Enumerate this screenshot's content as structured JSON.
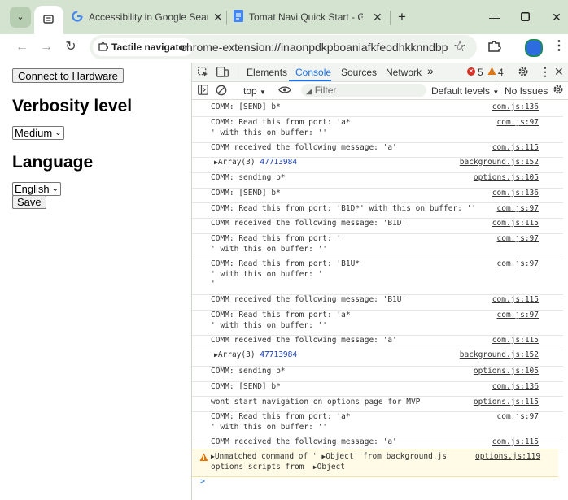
{
  "browser": {
    "tabs": [
      {
        "title": "",
        "favicon": "extension-page-icon",
        "active": true
      },
      {
        "title": "Accessibility in Google Search -",
        "favicon": "google-icon",
        "active": false
      },
      {
        "title": "Tomat Navi Quick Start - Googl",
        "favicon": "docs-icon",
        "active": false
      }
    ],
    "new_tab_symbol": "+",
    "site_chip": "Tactile navigator",
    "url": "chrome-extension://inaonpdkpboaniafkfeodhkknndbpma/o...",
    "colors": {
      "tabstrip": "#d3e3cf",
      "omnibox": "#edf2ec"
    }
  },
  "page": {
    "connect_button": "Connect to Hardware",
    "verbosity_heading": "Verbosity level",
    "verbosity_value": "Medium",
    "language_heading": "Language",
    "language_value": "English",
    "save_button": "Save"
  },
  "devtools": {
    "tabs": [
      "Elements",
      "Console",
      "Sources",
      "Network"
    ],
    "active_tab": "Console",
    "more_tabs": "»",
    "error_count": "5",
    "warning_count": "4",
    "context": "top",
    "filter_placeholder": "Filter",
    "levels": "Default levels",
    "issues": "No Issues",
    "messages": [
      {
        "text": "COMM: [SEND] b*",
        "source": "com.js:136"
      },
      {
        "text": "COMM: Read this from port: 'a*\n' with this on buffer: ''",
        "source": "com.js:97"
      },
      {
        "text": "COMM received the following message: 'a'",
        "source": "com.js:115"
      },
      {
        "text": "Array(3)",
        "extra": "47713984",
        "expandable": true,
        "source": "background.js:152"
      },
      {
        "text": "COMM: sending b*",
        "source": "options.js:105"
      },
      {
        "text": "COMM: [SEND] b*",
        "source": "com.js:136"
      },
      {
        "text": "COMM: Read this from port: 'B1D*' with this on buffer: ''",
        "source": "com.js:97"
      },
      {
        "text": "COMM received the following message: 'B1D'",
        "source": "com.js:115"
      },
      {
        "text": "COMM: Read this from port: '\n' with this on buffer: ''",
        "source": "com.js:97"
      },
      {
        "text": "COMM: Read this from port: 'B1U*\n' with this on buffer: '\n'",
        "source": "com.js:97"
      },
      {
        "text": "COMM received the following message: 'B1U'",
        "source": "com.js:115"
      },
      {
        "text": "COMM: Read this from port: 'a*\n' with this on buffer: ''",
        "source": "com.js:97"
      },
      {
        "text": "COMM received the following message: 'a'",
        "source": "com.js:115"
      },
      {
        "text": "Array(3)",
        "extra": "47713984",
        "expandable": true,
        "source": "background.js:152"
      },
      {
        "text": "COMM: sending b*",
        "source": "options.js:105"
      },
      {
        "text": "COMM: [SEND] b*",
        "source": "com.js:136"
      },
      {
        "text": "wont start navigation on options page for MVP",
        "source": "options.js:115"
      },
      {
        "text": "COMM: Read this from port: 'a*\n' with this on buffer: ''",
        "source": "com.js:97"
      },
      {
        "text": "COMM received the following message: 'a'",
        "source": "com.js:115"
      }
    ],
    "warning": {
      "line1_a": "Unmatched command of '",
      "line1_obj": "Object",
      "line1_b": "' from background.js",
      "line2_a": "options scripts from",
      "line2_obj": "Object",
      "source": "options.js:119"
    },
    "prompt": ">"
  }
}
